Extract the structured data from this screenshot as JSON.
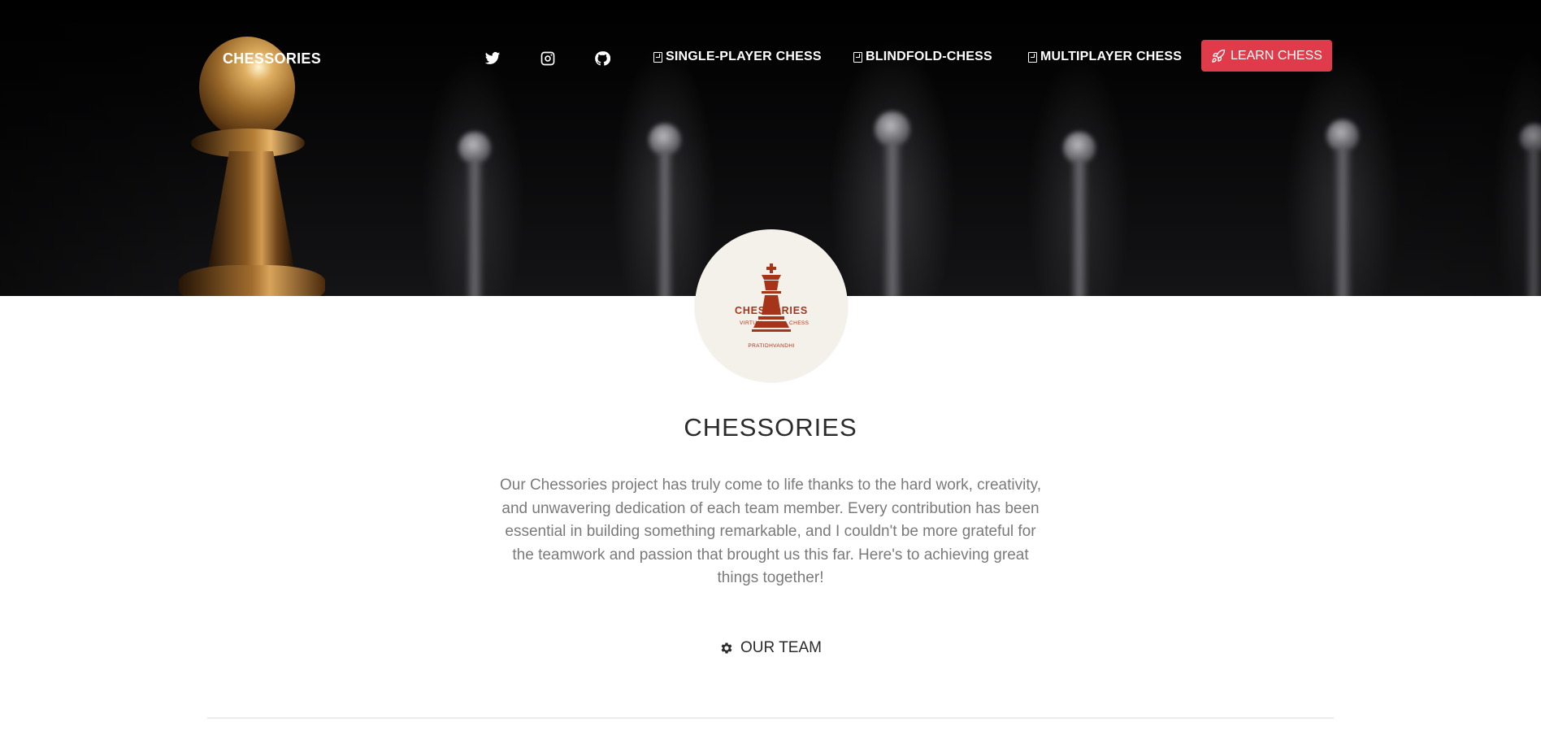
{
  "nav": {
    "brand": "CHESSORIES",
    "social": [
      "twitter-icon",
      "instagram-icon",
      "github-icon"
    ],
    "links": [
      {
        "label": "SINGLE-PLAYER CHESS",
        "icon": "document-icon"
      },
      {
        "label": "BLINDFOLD-CHESS",
        "icon": "document-icon"
      },
      {
        "label": "MULTIPLAYER CHESS",
        "icon": "document-icon"
      }
    ],
    "cta": {
      "label": "LEARN CHESS",
      "icon": "rocket-icon",
      "color": "#e03b4b"
    }
  },
  "logo": {
    "name": "CHESSORIES",
    "left_word": "VIRTUAL",
    "right_word": "CHESS",
    "bottom_word": "PRATIDHVANDHI",
    "color": "#a6341b",
    "background": "#f3f1ea"
  },
  "main": {
    "title": "CHESSORIES",
    "description": "Our Chessories project has truly come to life thanks to the hard work, creativity, and unwavering dedication of each team member. Every contribution has been essential in building something remarkable, and I couldn't be more grateful for the teamwork and passion that brought us this far. Here's to achieving great things together!",
    "team_label": "OUR TEAM",
    "team_icon": "gear-icon"
  }
}
